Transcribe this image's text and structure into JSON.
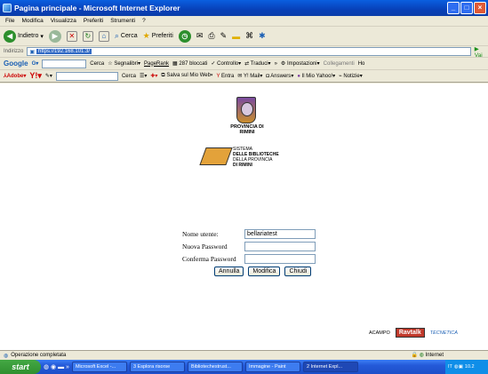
{
  "window": {
    "title": "Pagina principale - Microsoft Internet Explorer"
  },
  "menu": [
    "File",
    "Modifica",
    "Visualizza",
    "Preferiti",
    "Strumenti",
    "?"
  ],
  "toolbar": {
    "back": "Indietro",
    "search": "Cerca",
    "favorites": "Preferiti"
  },
  "address": {
    "label": "Indirizzo",
    "value": "https://192.168.101.3/",
    "go": "Vai"
  },
  "google_bar": {
    "brand": "Google",
    "search": "Cerca",
    "bookmarks": "Segnalibri",
    "pagerank": "PageRank",
    "blocked": "287 bloccati",
    "check": "Controllo",
    "translate": "Traduci",
    "settings": "Impostazioni",
    "links": "Collegamenti",
    "home": "Ho"
  },
  "yahoo_bar": {
    "adobe": "Adobe",
    "search": "Cerca",
    "save": "Salva sul Mio Web",
    "enter": "Entra",
    "mail": "Y! Mail",
    "answers": "Answers",
    "my_yahoo": "Il Mio Yahoo!",
    "news": "Notizie"
  },
  "page": {
    "province": "PROVINCIA DI RIMINI",
    "system_1": "SISTEMA",
    "system_2": "DELLE BIBLIOTECHE",
    "system_3": "DELLA PROVINCIA",
    "system_4": "DI RIMINI",
    "form": {
      "username_label": "Nome utente:",
      "username_value": "bellariatest",
      "new_password_label": "Nuova Password",
      "confirm_password_label": "Conferma Password",
      "cancel": "Annulla",
      "modify": "Modifica",
      "close": "Chiudi"
    },
    "logos": {
      "acamp": "ACAMPO",
      "ravtalk": "Ravtalk",
      "tecnetica": "TECNETICA"
    }
  },
  "status": {
    "text": "Operazione completata",
    "zone": "Internet"
  },
  "taskbar": {
    "start": "start",
    "tasks": [
      "Microsoft Excel -...",
      "3 Esplora risorse",
      "Bibliotechestrust...",
      "Immagine - Paint",
      "2 Internet Expl..."
    ],
    "lang": "IT",
    "clock": "10.2"
  }
}
